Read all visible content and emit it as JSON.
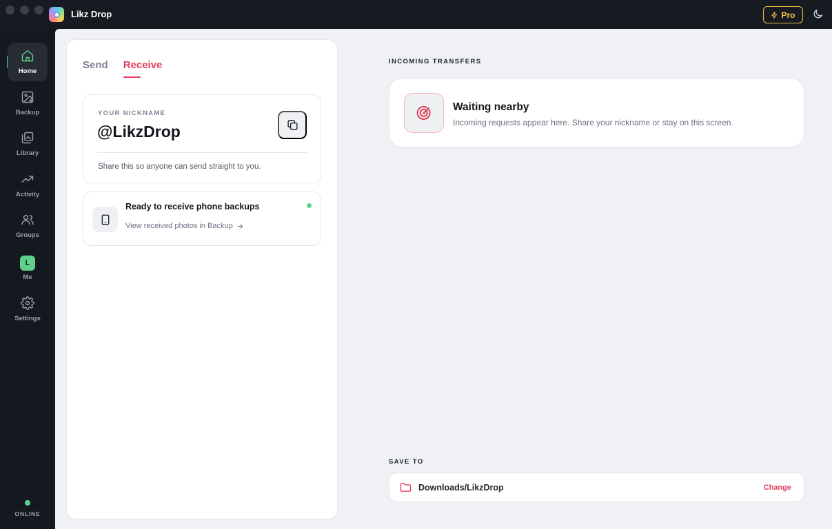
{
  "window": {
    "title": "Likz Drop",
    "pro_label": "Pro"
  },
  "sidebar": {
    "items": [
      {
        "label": "Home",
        "icon": "home-icon",
        "active": true
      },
      {
        "label": "Backup",
        "icon": "image-plus-icon"
      },
      {
        "label": "Library",
        "icon": "gallery-icon"
      },
      {
        "label": "Activity",
        "icon": "trending-up-icon"
      },
      {
        "label": "Groups",
        "icon": "users-icon"
      },
      {
        "label": "Me",
        "icon": "avatar",
        "avatar_letter": "L"
      },
      {
        "label": "Settings",
        "icon": "gear-icon"
      }
    ],
    "status": "ONLINE"
  },
  "receive_panel": {
    "tabs": [
      {
        "label": "Send",
        "active": false
      },
      {
        "label": "Receive",
        "active": true
      }
    ],
    "nickname_card": {
      "label": "YOUR NICKNAME",
      "value": "@LikzDrop",
      "hint": "Share this so anyone can send straight to you."
    },
    "backup_card": {
      "title": "Ready to receive phone backups",
      "link": "View received photos in Backup"
    }
  },
  "incoming": {
    "section_label": "INCOMING TRANSFERS",
    "title": "Waiting nearby",
    "subtitle": "Incoming requests appear here. Share your nickname or stay on this screen."
  },
  "save_to": {
    "section_label": "SAVE TO",
    "path": "Downloads/LikzDrop",
    "change_label": "Change"
  },
  "colors": {
    "accent": "#e0405a",
    "online": "#5fd08a",
    "pro": "#f2c14a"
  }
}
